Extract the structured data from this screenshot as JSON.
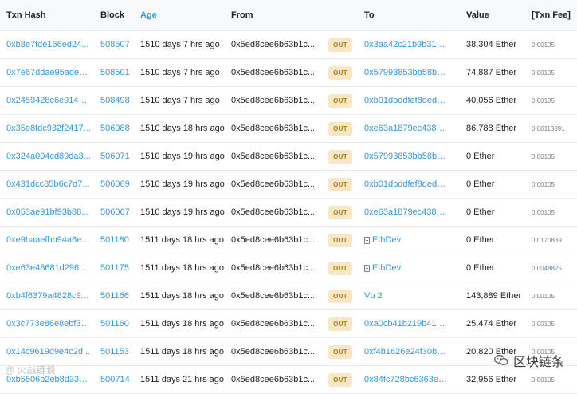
{
  "header": {
    "txn_hash": "Txn Hash",
    "block": "Block",
    "age": "Age",
    "from": "From",
    "to": "To",
    "value": "Value",
    "txn_fee": "[Txn Fee]"
  },
  "rows": [
    {
      "hash": "0xb8e7fde166ed24...",
      "block": "508507",
      "age": "1510 days 7 hrs ago",
      "from": "0x5ed8cee6b63b1c...",
      "dir": "OUT",
      "to": "0x3aa42c21b9b31c...",
      "to_contract": false,
      "value": "38,304 Ether",
      "fee": "0.00105"
    },
    {
      "hash": "0x7e67ddae95ade0...",
      "block": "508501",
      "age": "1510 days 7 hrs ago",
      "from": "0x5ed8cee6b63b1c...",
      "dir": "OUT",
      "to": "0x57993853bb58ba...",
      "to_contract": false,
      "value": "74,887 Ether",
      "fee": "0.00105"
    },
    {
      "hash": "0x2459428c6e9146f...",
      "block": "508498",
      "age": "1510 days 7 hrs ago",
      "from": "0x5ed8cee6b63b1c...",
      "dir": "OUT",
      "to": "0xb01dbddfef8dedb...",
      "to_contract": false,
      "value": "40,056 Ether",
      "fee": "0.00105"
    },
    {
      "hash": "0x35e8fdc932f2417...",
      "block": "506088",
      "age": "1510 days 18 hrs ago",
      "from": "0x5ed8cee6b63b1c...",
      "dir": "OUT",
      "to": "0xe63a1879ec438fd...",
      "to_contract": false,
      "value": "86,788 Ether",
      "fee": "0.00113891"
    },
    {
      "hash": "0x324a004cd89da3...",
      "block": "506071",
      "age": "1510 days 19 hrs ago",
      "from": "0x5ed8cee6b63b1c...",
      "dir": "OUT",
      "to": "0x57993853bb58ba...",
      "to_contract": false,
      "value": "0 Ether",
      "fee": "0.00105"
    },
    {
      "hash": "0x431dcc85b6c7d7...",
      "block": "506069",
      "age": "1510 days 19 hrs ago",
      "from": "0x5ed8cee6b63b1c...",
      "dir": "OUT",
      "to": "0xb01dbddfef8dedb...",
      "to_contract": false,
      "value": "0 Ether",
      "fee": "0.00105"
    },
    {
      "hash": "0x053ae91bf93b88...",
      "block": "506067",
      "age": "1510 days 19 hrs ago",
      "from": "0x5ed8cee6b63b1c...",
      "dir": "OUT",
      "to": "0xe63a1879ec438fd...",
      "to_contract": false,
      "value": "0 Ether",
      "fee": "0.00105"
    },
    {
      "hash": "0xe9baaefbb94a6ee...",
      "block": "501180",
      "age": "1511 days 18 hrs ago",
      "from": "0x5ed8cee6b63b1c...",
      "dir": "OUT",
      "to": "EthDev",
      "to_contract": true,
      "value": "0 Ether",
      "fee": "0.0170839"
    },
    {
      "hash": "0xe63e48681d2969...",
      "block": "501175",
      "age": "1511 days 18 hrs ago",
      "from": "0x5ed8cee6b63b1c...",
      "dir": "OUT",
      "to": "EthDev",
      "to_contract": true,
      "value": "0 Ether",
      "fee": "0.0048825"
    },
    {
      "hash": "0xb4f6379a4828c9...",
      "block": "501166",
      "age": "1511 days 18 hrs ago",
      "from": "0x5ed8cee6b63b1c...",
      "dir": "OUT",
      "to": "Vb 2",
      "to_contract": false,
      "value": "143,889 Ether",
      "fee": "0.00105"
    },
    {
      "hash": "0x3c773e86e8ebf30...",
      "block": "501160",
      "age": "1511 days 18 hrs ago",
      "from": "0x5ed8cee6b63b1c...",
      "dir": "OUT",
      "to": "0xa0cb41b219b416...",
      "to_contract": false,
      "value": "25,474 Ether",
      "fee": "0.00105"
    },
    {
      "hash": "0x14c9619d9e4c2d...",
      "block": "501153",
      "age": "1511 days 18 hrs ago",
      "from": "0x5ed8cee6b63b1c...",
      "dir": "OUT",
      "to": "0xf4b1626e24f30bc...",
      "to_contract": false,
      "value": "20,820 Ether",
      "fee": "0.00105"
    },
    {
      "hash": "0xb5506b2eb8d3344...",
      "block": "500714",
      "age": "1511 days 21 hrs ago",
      "from": "0x5ed8cee6b63b1c...",
      "dir": "OUT",
      "to": "0x84fc728bc6363e6...",
      "to_contract": false,
      "value": "32,956 Ether",
      "fee": "0.00105"
    }
  ],
  "watermark": {
    "left_text": "@ 火战链谈",
    "right_text": "区块链条",
    "icon": "wechat-icon"
  },
  "colors": {
    "link": "#3498db",
    "out_badge_bg": "#f8e7c6",
    "out_badge_text": "#b47d00"
  }
}
